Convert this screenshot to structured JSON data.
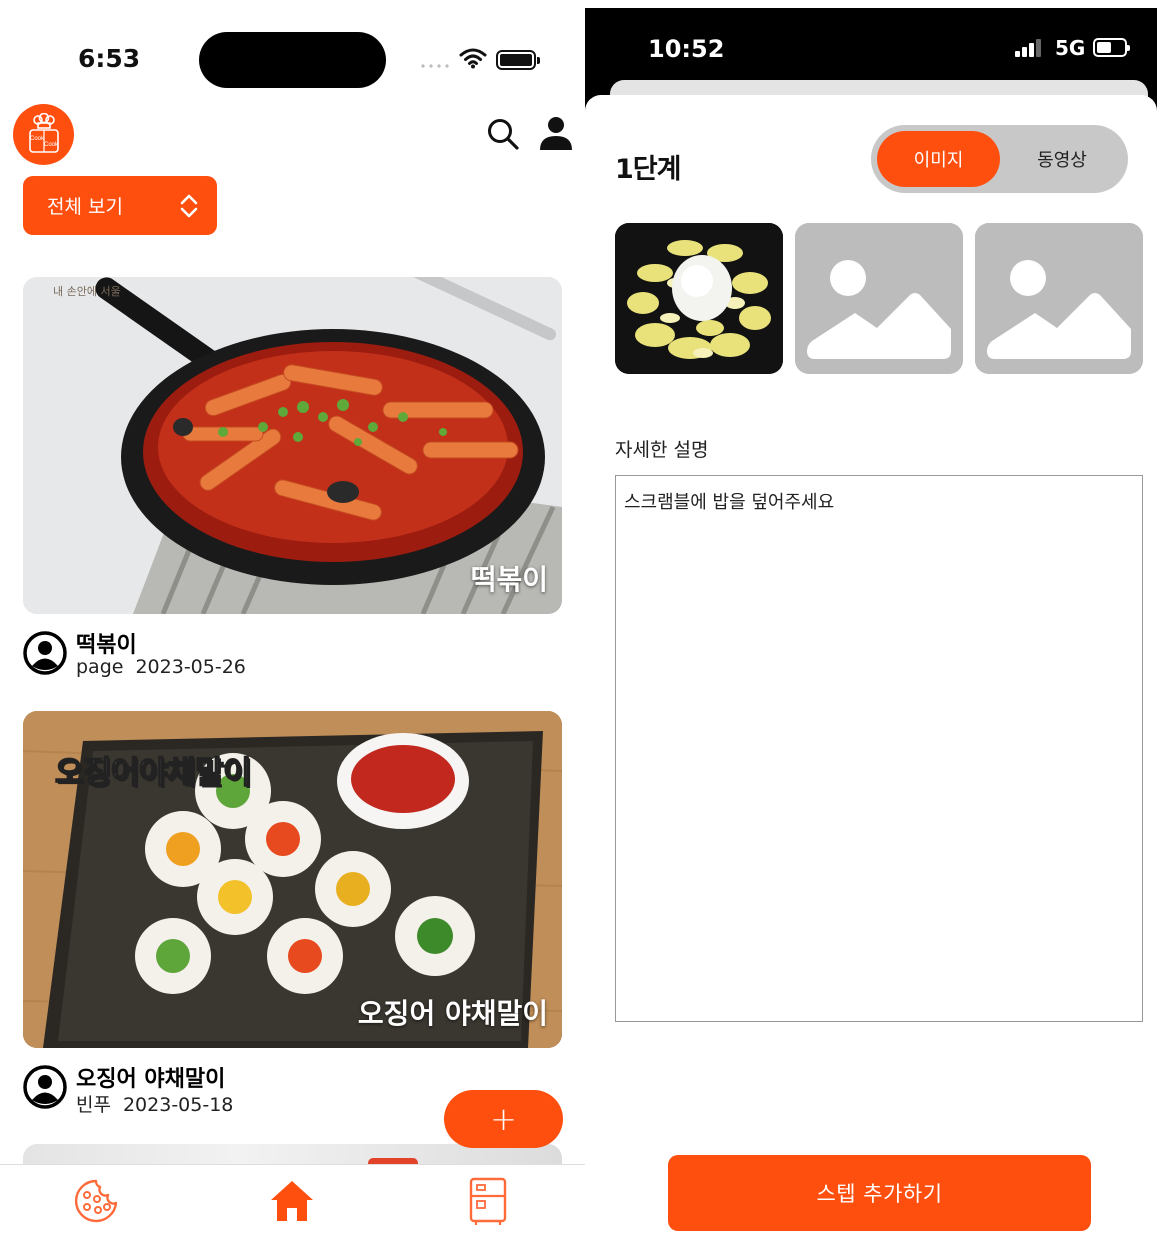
{
  "left_screen": {
    "status_bar": {
      "time": "6:53"
    },
    "header": {
      "logo_icon": "chef-logo-icon",
      "search_icon": "search-icon",
      "profile_icon": "person-icon"
    },
    "filter": {
      "label": "전체 보기",
      "icon": "chevron-up-down-icon"
    },
    "posts": [
      {
        "image_caption": "떡볶이",
        "image_watermark": "내 손안에 서울",
        "title": "떡볶이",
        "author": "page",
        "date": "2023-05-26"
      },
      {
        "image_caption_top": "오징어야채말이",
        "image_caption": "오징어 야채말이",
        "title": "오징어 야채말이",
        "author": "빈푸",
        "date": "2023-05-18"
      }
    ],
    "fab": {
      "label": "+"
    },
    "tab_bar": {
      "items": [
        {
          "icon": "cookie-icon",
          "active": false
        },
        {
          "icon": "home-icon",
          "active": true
        },
        {
          "icon": "fridge-icon",
          "active": false
        }
      ]
    }
  },
  "right_screen": {
    "status_bar": {
      "time": "10:52",
      "network": "5G"
    },
    "step": {
      "title": "1단계"
    },
    "media_toggle": {
      "options": [
        "이미지",
        "동영상"
      ],
      "selected": "이미지"
    },
    "images": [
      {
        "type": "photo",
        "icon": "scrambled-egg-rice-photo"
      },
      {
        "type": "placeholder",
        "icon": "image-placeholder-icon"
      },
      {
        "type": "placeholder",
        "icon": "image-placeholder-icon"
      }
    ],
    "description": {
      "label": "자세한 설명",
      "value": "스크램블에 밥을 덮어주세요"
    },
    "add_step_button": {
      "label": "스텝 추가하기"
    }
  },
  "colors": {
    "accent": "#ff4f0f",
    "placeholder_gray": "#bcbcbc",
    "toggle_track": "#c8c8c8"
  }
}
